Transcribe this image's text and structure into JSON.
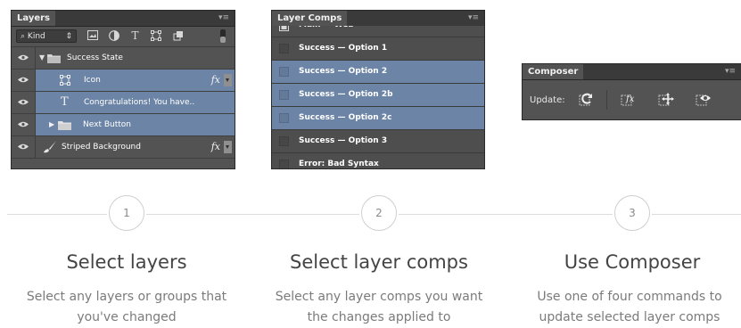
{
  "layers_panel": {
    "tab": "Layers",
    "menu_glyph": "▾≡",
    "filter": {
      "kind_label": "Kind",
      "icons": [
        "image-filter-icon",
        "adjustment-filter-icon",
        "type-filter-icon",
        "shape-filter-icon",
        "smart-object-filter-icon"
      ],
      "type_glyph": "T"
    },
    "layers": [
      {
        "name": "Success State",
        "kind": "group",
        "expanded": true,
        "selected": false
      },
      {
        "name": "Icon",
        "kind": "shape",
        "selected": true,
        "fx": "fx"
      },
      {
        "name": "Congratulations! You have..",
        "kind": "text",
        "glyph": "T",
        "selected": true
      },
      {
        "name": "Next Button",
        "kind": "group",
        "expanded": false,
        "selected": true
      },
      {
        "name": "Striped Background",
        "kind": "brush",
        "selected": false,
        "fx": "fx"
      }
    ]
  },
  "comps_panel": {
    "tab": "Layer Comps",
    "menu_glyph": "▾≡",
    "comps": [
      {
        "name": "Main — Web",
        "selected": false
      },
      {
        "name": "Success — Option 1",
        "selected": false
      },
      {
        "name": "Success — Option 2",
        "selected": true
      },
      {
        "name": "Success — Option 2b",
        "selected": true
      },
      {
        "name": "Success — Option 2c",
        "selected": true
      },
      {
        "name": "Success — Option 3",
        "selected": false
      },
      {
        "name": "Error: Bad Syntax",
        "selected": false
      }
    ]
  },
  "composer_panel": {
    "tab": "Composer",
    "menu_glyph": "▾≡",
    "update_label": "Update:",
    "commands": [
      "refresh-icon",
      "fx-update-icon",
      "position-update-icon",
      "visibility-update-icon"
    ],
    "fx_glyph": "fx"
  },
  "steps": [
    {
      "number": "1",
      "title": "Select layers",
      "description": "Select any layers or groups that you've changed"
    },
    {
      "number": "2",
      "title": "Select layer comps",
      "description": "Select any layer comps you want the changes applied to"
    },
    {
      "number": "3",
      "title": "Use Composer",
      "description": "Use one of four commands to update selected layer comps"
    }
  ],
  "colors": {
    "panel": "#535353",
    "selected_row": "#6c85a6",
    "title_text": "#444444",
    "desc_text": "#7b7b7b"
  }
}
